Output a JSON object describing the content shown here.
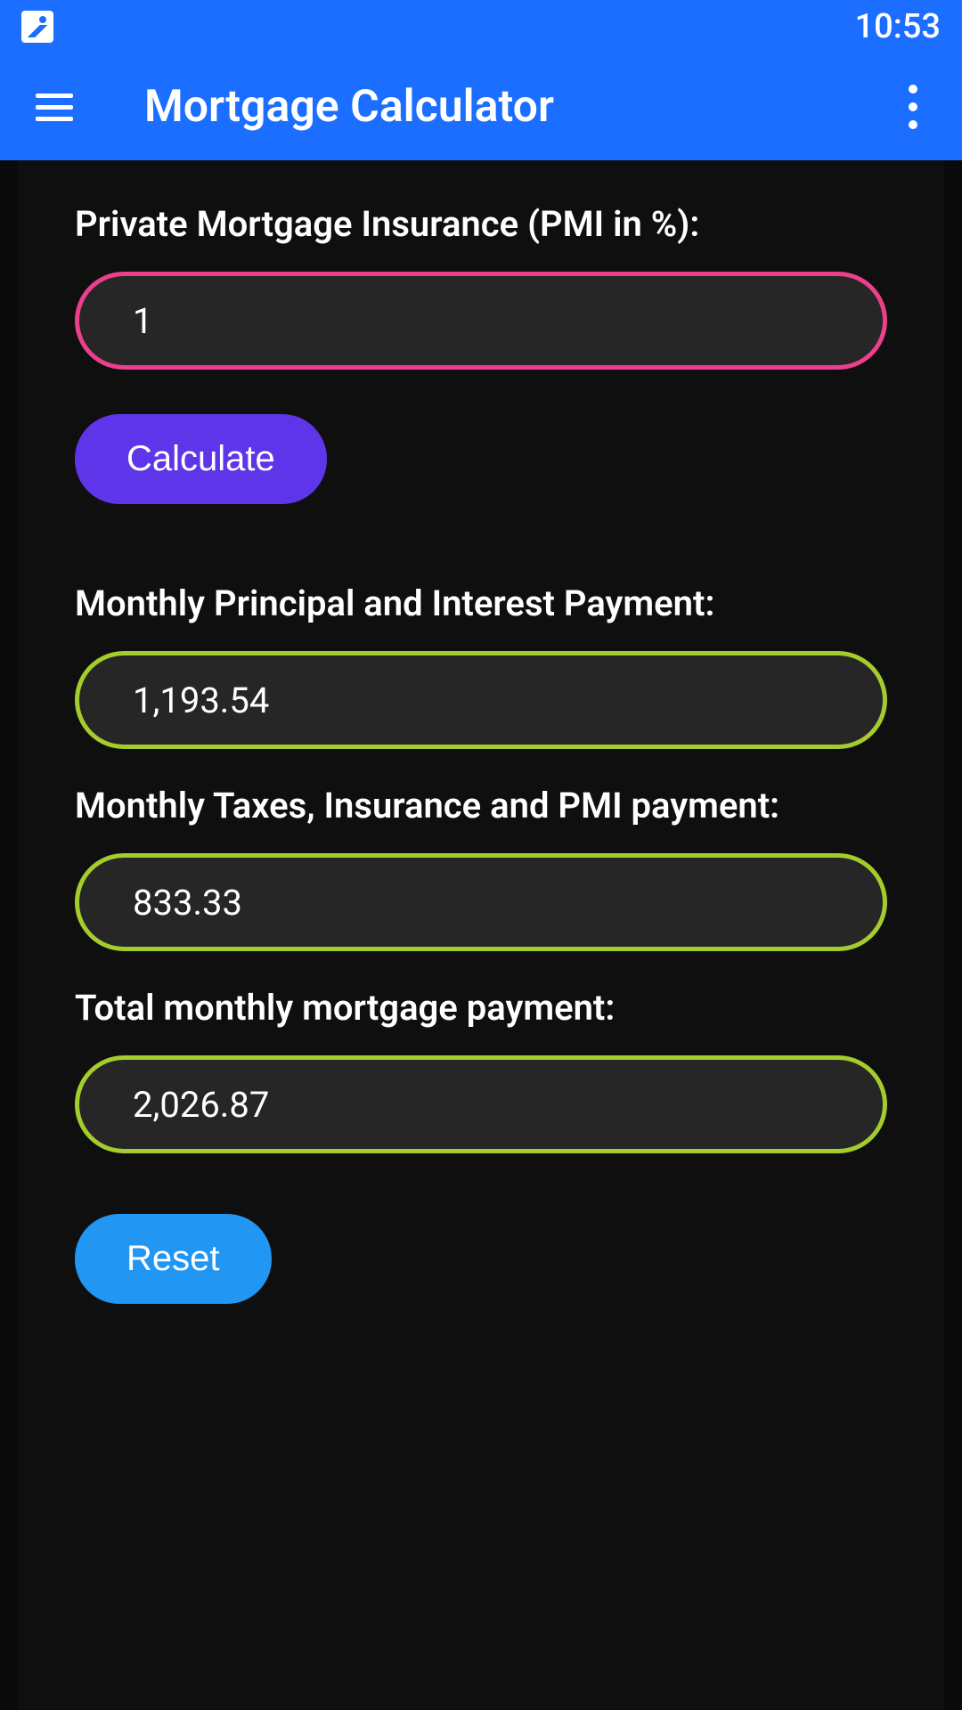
{
  "status": {
    "time": "10:53"
  },
  "header": {
    "title": "Mortgage Calculator"
  },
  "fields": {
    "pmi": {
      "label": "Private Mortgage Insurance (PMI in %):",
      "value": "1"
    },
    "principalInterest": {
      "label": "Monthly Principal and Interest Payment:",
      "value": "1,193.54"
    },
    "taxesInsurance": {
      "label": "Monthly Taxes, Insurance and PMI payment:",
      "value": "833.33"
    },
    "totalMonthly": {
      "label": "Total monthly mortgage payment:",
      "value": "2,026.87"
    }
  },
  "buttons": {
    "calculate": "Calculate",
    "reset": "Reset"
  }
}
